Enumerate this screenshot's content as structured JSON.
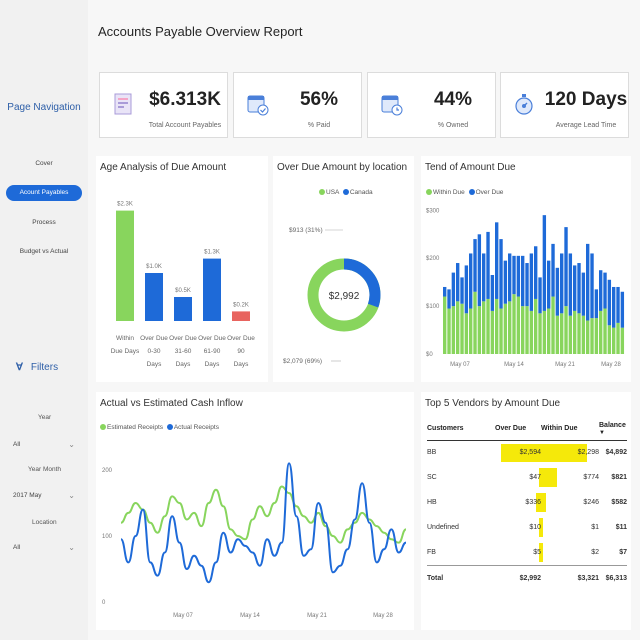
{
  "title": "Accounts Payable Overview Report",
  "sidebar": {
    "heading": "Page Navigation",
    "items": [
      {
        "label": "Cover",
        "active": false
      },
      {
        "label": "Acount Payables",
        "active": true
      },
      {
        "label": "Process",
        "active": false
      },
      {
        "label": "Budget vs Actual",
        "active": false
      }
    ],
    "filters_label": "Filters",
    "filters": [
      {
        "label": "Year",
        "value": "All"
      },
      {
        "label": "Year Month",
        "value": "2017 May"
      },
      {
        "label": "Location",
        "value": "All"
      }
    ]
  },
  "kpis": [
    {
      "value": "$6.313K",
      "label": "Total Account Payables",
      "icon": "invoice-icon"
    },
    {
      "value": "56%",
      "label": "% Paid",
      "icon": "calendar-check-icon"
    },
    {
      "value": "44%",
      "label": "% Owned",
      "icon": "calendar-clock-icon"
    },
    {
      "value": "120 Days",
      "label": "Average Lead Time",
      "icon": "stopwatch-icon"
    }
  ],
  "colors": {
    "green": "#88d55d",
    "blue": "#1e6ad8",
    "red": "#e8645f",
    "highlight": "#f5e90a"
  },
  "chart_data": [
    {
      "type": "bar",
      "title": "Age Analysis of Due Amount",
      "categories": [
        "Within Due Days",
        "Over Due 0-30 Days",
        "Over Due 31-60 Days",
        "Over Due 61-90 Days",
        "Over Due 90 Days"
      ],
      "values": [
        2.3,
        1.0,
        0.5,
        1.3,
        0.2
      ],
      "data_labels": [
        "$2.3K",
        "$1.0K",
        "$0.5K",
        "$1.3K",
        "$0.2K"
      ],
      "colors": [
        "#88d55d",
        "#1e6ad8",
        "#1e6ad8",
        "#1e6ad8",
        "#e8645f"
      ]
    },
    {
      "type": "pie",
      "title": "Over Due Amount by location",
      "legend": [
        "USA",
        "Canada"
      ],
      "values": [
        2079,
        913
      ],
      "labels": [
        "$2,079 (69%)",
        "$913 (31%)"
      ],
      "center_label": "$2,992"
    },
    {
      "type": "bar",
      "title": "Tend of Amount Due",
      "legend": [
        "Within Due",
        "Over Due"
      ],
      "yticks": [
        "$300",
        "$200",
        "$100",
        "$0"
      ],
      "xticks": [
        "May 07",
        "May 14",
        "May 21",
        "May 28"
      ],
      "ylim": [
        0,
        330
      ],
      "within_due": [
        120,
        95,
        100,
        110,
        105,
        85,
        95,
        130,
        100,
        110,
        115,
        90,
        115,
        95,
        105,
        110,
        125,
        120,
        100,
        100,
        90,
        115,
        85,
        90,
        95,
        120,
        80,
        85,
        100,
        80,
        90,
        85,
        80,
        70,
        75,
        75,
        90,
        95,
        60,
        55,
        65,
        55
      ],
      "over_due": [
        20,
        40,
        70,
        80,
        55,
        100,
        115,
        110,
        150,
        100,
        140,
        75,
        160,
        145,
        90,
        100,
        80,
        85,
        105,
        90,
        120,
        110,
        75,
        200,
        100,
        110,
        100,
        125,
        165,
        130,
        95,
        105,
        90,
        160,
        135,
        60,
        85,
        75,
        95,
        85,
        75,
        75
      ]
    },
    {
      "type": "line",
      "title": "Actual vs Estimated Cash Inflow",
      "legend": [
        "Estimated Receipts",
        "Actual Receipts"
      ],
      "yticks": [
        "200",
        "100",
        "0"
      ],
      "xticks": [
        "May 07",
        "May 14",
        "May 21",
        "May 28"
      ],
      "ylim": [
        0,
        250
      ],
      "series": [
        {
          "name": "Estimated Receipts",
          "values": [
            120,
            135,
            150,
            140,
            120,
            105,
            130,
            160,
            150,
            125,
            135,
            115,
            150,
            170,
            145,
            110,
            100,
            95,
            125,
            145,
            130,
            150,
            175,
            165,
            145,
            130,
            120,
            135,
            115,
            100,
            90,
            110,
            120,
            135,
            125,
            115,
            105,
            95,
            90,
            110
          ]
        },
        {
          "name": "Actual Receipts",
          "values": [
            95,
            60,
            100,
            140,
            60,
            40,
            75,
            130,
            90,
            50,
            70,
            55,
            30,
            60,
            105,
            75,
            95,
            85,
            75,
            55,
            95,
            70,
            90,
            210,
            130,
            70,
            80,
            150,
            120,
            45,
            55,
            80,
            125,
            180,
            120,
            60,
            80,
            110,
            75,
            90
          ]
        }
      ]
    }
  ],
  "vendors": {
    "title": "Top 5 Vendors by Amount Due",
    "columns": [
      "Customers",
      "Over Due",
      "Within Due",
      "Balance"
    ],
    "rows": [
      {
        "name": "BB",
        "over_due": "$2,594",
        "within_due": "$2,298",
        "balance": "$4,892",
        "od": 2594,
        "wd": 2298
      },
      {
        "name": "SC",
        "over_due": "$47",
        "within_due": "$774",
        "balance": "$821",
        "od": 47,
        "wd": 774
      },
      {
        "name": "HB",
        "over_due": "$336",
        "within_due": "$246",
        "balance": "$582",
        "od": 336,
        "wd": 246
      },
      {
        "name": "Undefined",
        "over_due": "$10",
        "within_due": "$1",
        "balance": "$11",
        "od": 10,
        "wd": 1
      },
      {
        "name": "FB",
        "over_due": "$5",
        "within_due": "$2",
        "balance": "$7",
        "od": 5,
        "wd": 2
      }
    ],
    "total": {
      "name": "Total",
      "over_due": "$2,992",
      "within_due": "$3,321",
      "balance": "$6,313"
    }
  }
}
